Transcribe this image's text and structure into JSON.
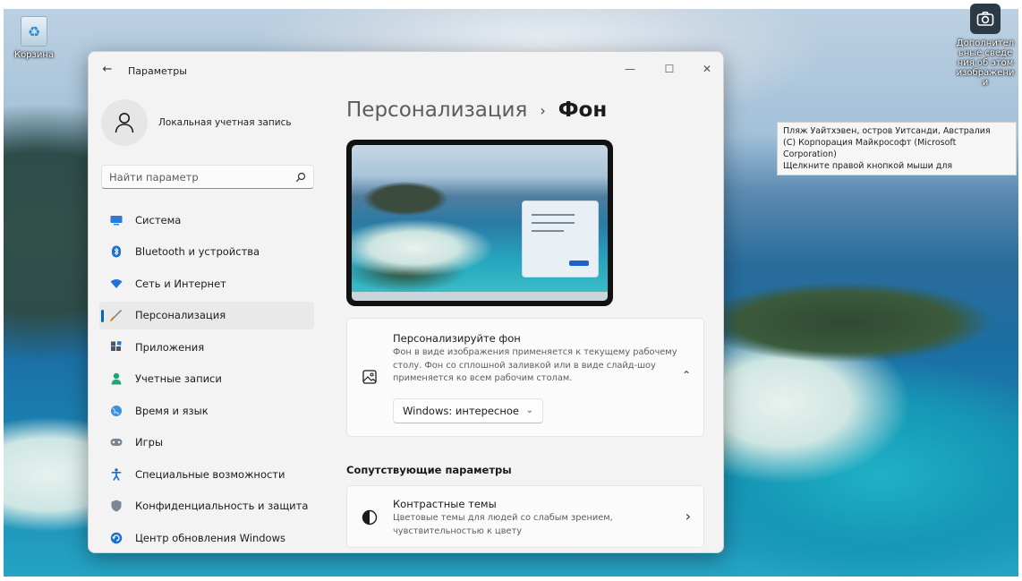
{
  "desktop": {
    "recycle_bin_label": "Корзина",
    "spotlight_label": "Дополнительные сведения об этом изображении",
    "spotlight_tooltip": [
      "Пляж Уайтхэвен, остров Уитсанди, Австралия",
      "(С) Корпорация Майкрософт (Microsoft Corporation)",
      "Щелкните правой кнопкой мыши для"
    ]
  },
  "window": {
    "title": "Параметры",
    "controls": {
      "minimize": "—",
      "maximize": "☐",
      "close": "✕"
    }
  },
  "user": {
    "name": "Локальная учетная запись"
  },
  "search": {
    "placeholder": "Найти параметр"
  },
  "nav": {
    "items": [
      {
        "label": "Система",
        "icon": "display-icon",
        "color": "#2b7bd3"
      },
      {
        "label": "Bluetooth и устройства",
        "icon": "bluetooth-icon",
        "color": "#1a6fd1"
      },
      {
        "label": "Сеть и Интернет",
        "icon": "wifi-icon",
        "color": "#2272d6"
      },
      {
        "label": "Персонализация",
        "icon": "brush-icon",
        "color": "#d58430",
        "active": true
      },
      {
        "label": "Приложения",
        "icon": "apps-icon",
        "color": "#4a5866"
      },
      {
        "label": "Учетные записи",
        "icon": "person-icon",
        "color": "#22a37a"
      },
      {
        "label": "Время и язык",
        "icon": "globe-icon",
        "color": "#3c8fd8"
      },
      {
        "label": "Игры",
        "icon": "gamepad-icon",
        "color": "#7a8791"
      },
      {
        "label": "Специальные возможности",
        "icon": "accessibility-icon",
        "color": "#1a6fd1"
      },
      {
        "label": "Конфиденциальность и защита",
        "icon": "shield-icon",
        "color": "#7b8794"
      },
      {
        "label": "Центр обновления Windows",
        "icon": "update-icon",
        "color": "#1a6fd1"
      }
    ]
  },
  "content": {
    "breadcrumb_parent": "Персонализация",
    "breadcrumb_separator": "›",
    "breadcrumb_current": "Фон",
    "background_card": {
      "title": "Персонализируйте фон",
      "description": [
        "Фон в виде изображения применяется к текущему рабочему",
        "столу. Фон со сплошной заливкой или в виде слайд-шоу",
        "применяется ко всем рабочим столам."
      ],
      "dropdown_value": "Windows: интересное",
      "expanded_chevron": "⌃",
      "dropdown_chevron": "⌄"
    },
    "related_title": "Сопутствующие параметры",
    "contrast_card": {
      "title": "Контрастные темы",
      "description": [
        "Цветовые темы для людей со слабым зрением,",
        "чувствительностью к цвету"
      ],
      "chevron": "›"
    }
  }
}
